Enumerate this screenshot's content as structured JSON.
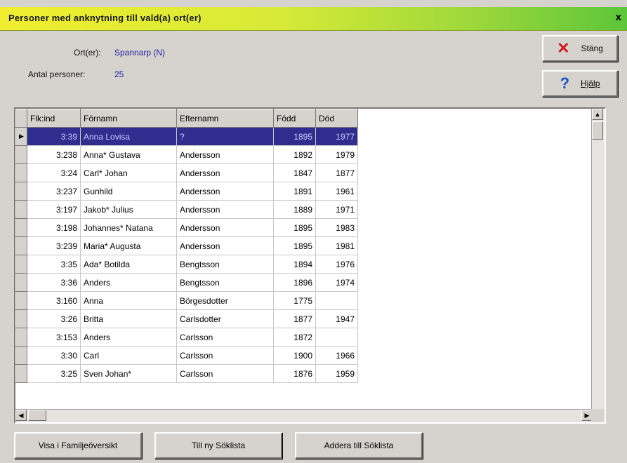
{
  "window": {
    "title": "Personer med anknytning till vald(a) ort(er)",
    "close_glyph": "x"
  },
  "info": {
    "ort_label": "Ort(er):",
    "ort_value": "Spannarp (N)",
    "count_label": "Antal personer:",
    "count_value": "25"
  },
  "buttons": {
    "close": "Stäng",
    "help": "Hjälp",
    "family": "Visa i Familjeöversikt",
    "new_list": "Till ny Söklista",
    "add_list": "Addera till Söklista"
  },
  "icons": {
    "close": "red-x-icon",
    "help": "blue-question-icon"
  },
  "grid": {
    "columns": [
      "Flk:ind",
      "Förnamn",
      "Efternamn",
      "Född",
      "Död"
    ],
    "rows": [
      [
        "3:39",
        "Anna Lovisa",
        "?",
        "1895",
        "1977"
      ],
      [
        "3:238",
        "Anna* Gustava",
        "Andersson",
        "1892",
        "1979"
      ],
      [
        "3:24",
        "Carl* Johan",
        "Andersson",
        "1847",
        "1877"
      ],
      [
        "3:237",
        "Gunhild",
        "Andersson",
        "1891",
        "1961"
      ],
      [
        "3:197",
        "Jakob* Julius",
        "Andersson",
        "1889",
        "1971"
      ],
      [
        "3:198",
        "Johannes* Natana",
        "Andersson",
        "1895",
        "1983"
      ],
      [
        "3:239",
        "Maria* Augusta",
        "Andersson",
        "1895",
        "1981"
      ],
      [
        "3:35",
        "Ada* Botilda",
        "Bengtsson",
        "1894",
        "1976"
      ],
      [
        "3:36",
        "Anders",
        "Bengtsson",
        "1896",
        "1974"
      ],
      [
        "3:160",
        "Anna",
        "Börgesdotter",
        "1775",
        ""
      ],
      [
        "3:26",
        "Britta",
        "Carlsdotter",
        "1877",
        "1947"
      ],
      [
        "3:153",
        "Anders",
        "Carlsson",
        "1872",
        ""
      ],
      [
        "3:30",
        "Carl",
        "Carlsson",
        "1900",
        "1966"
      ],
      [
        "3:25",
        "Sven Johan*",
        "Carlsson",
        "1876",
        "1959"
      ]
    ],
    "selected_row": 0
  }
}
